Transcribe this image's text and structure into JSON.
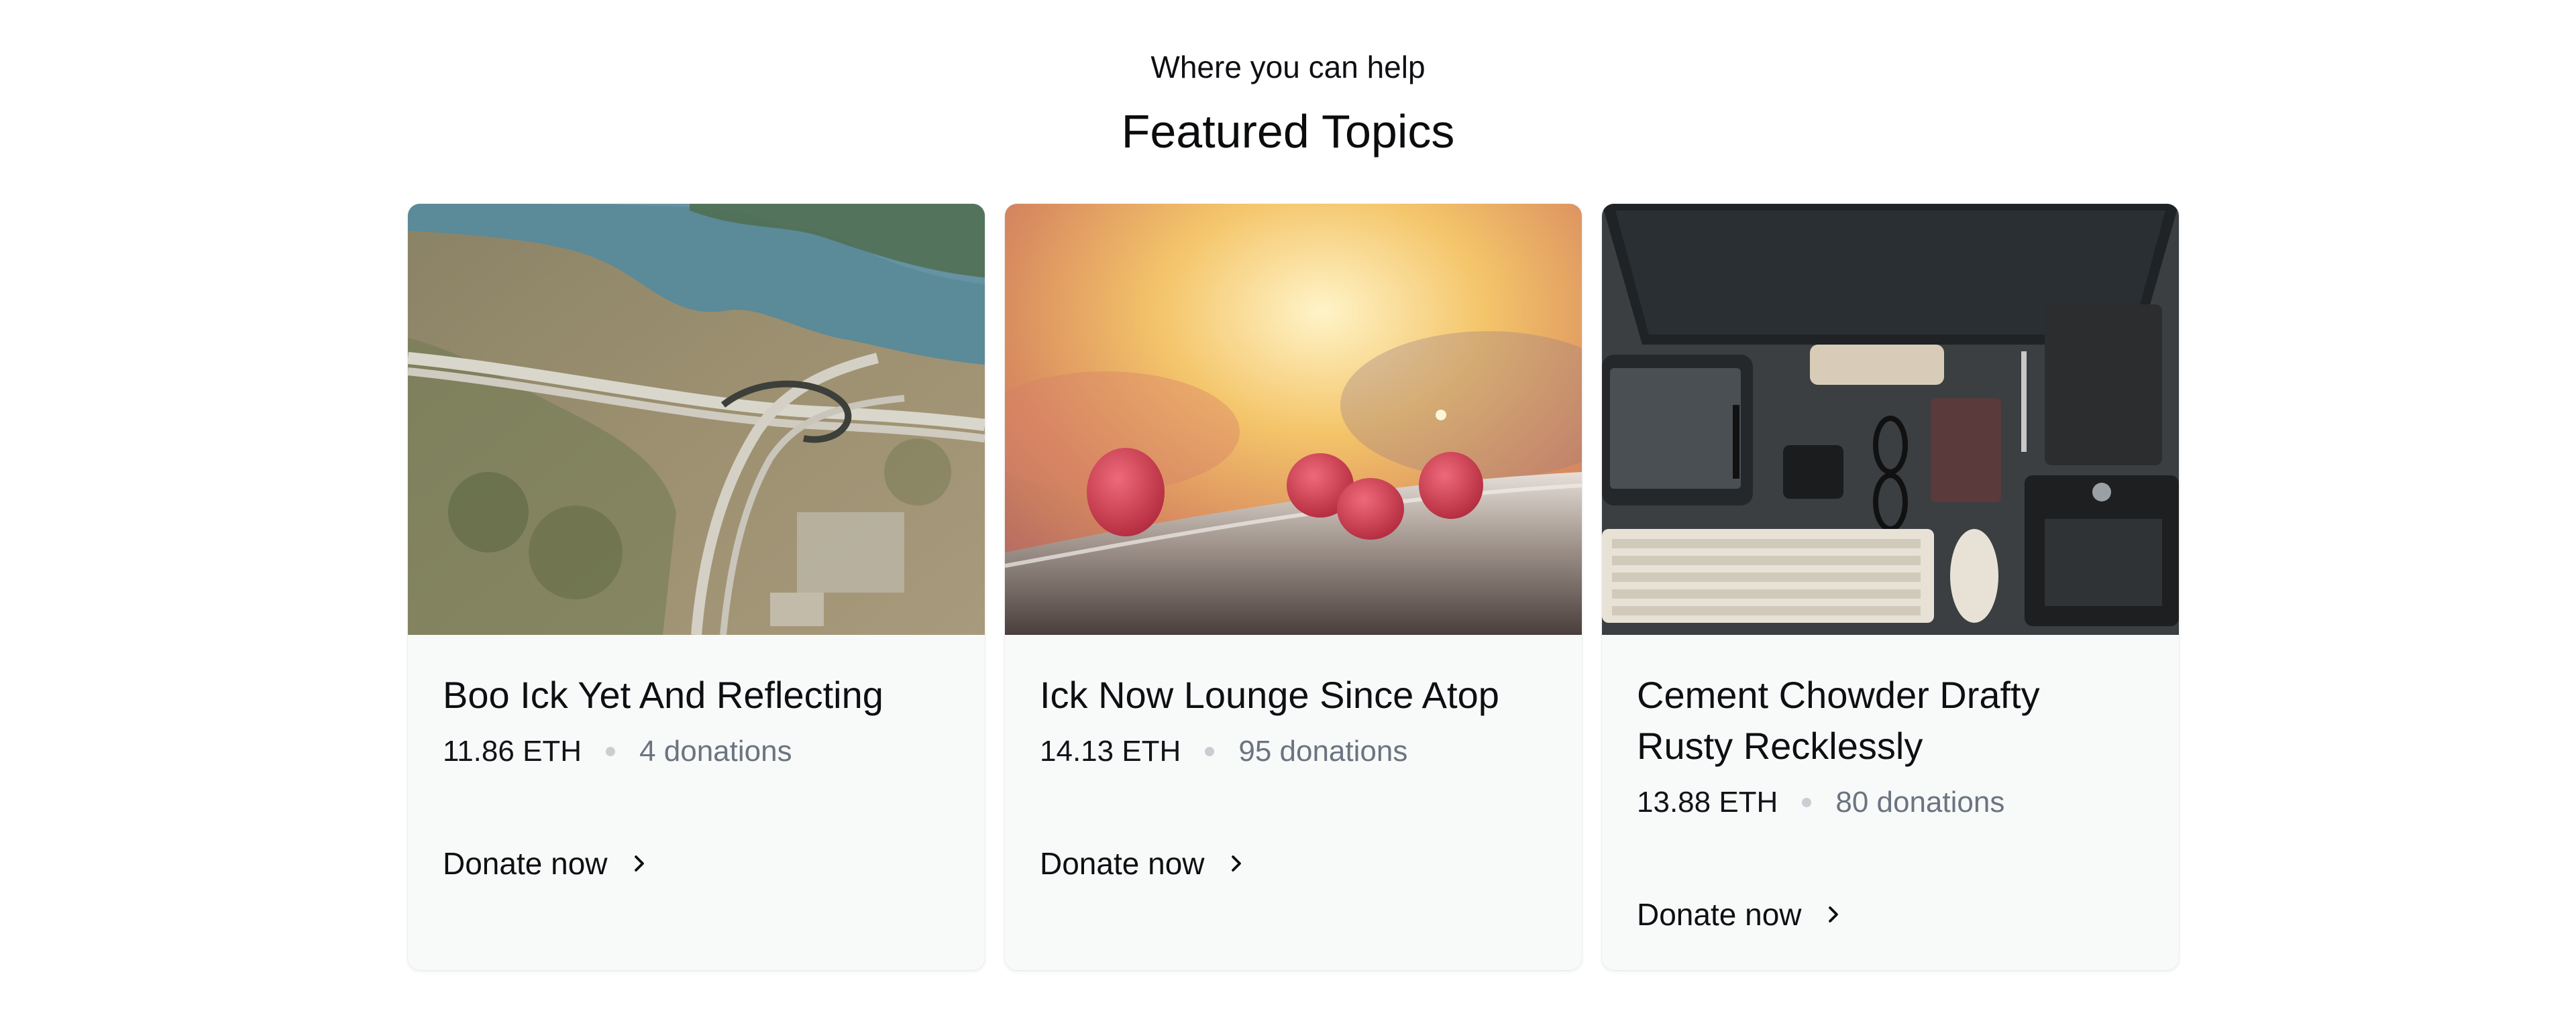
{
  "section": {
    "kicker": "Where you can help",
    "heading": "Featured Topics"
  },
  "cards": [
    {
      "title": "Boo Ick Yet And Reflecting",
      "amount": "11.86 ETH",
      "donations": "4 donations",
      "cta": "Donate now",
      "image_icon": "aerial-highway-photo"
    },
    {
      "title": "Ick Now Lounge Since Atop",
      "amount": "14.13 ETH",
      "donations": "95 donations",
      "cta": "Donate now",
      "image_icon": "raspberries-photo"
    },
    {
      "title": "Cement Chowder Drafty Rusty Recklessly",
      "amount": "13.88 ETH",
      "donations": "80 donations",
      "cta": "Donate now",
      "image_icon": "desk-workspace-photo"
    }
  ]
}
